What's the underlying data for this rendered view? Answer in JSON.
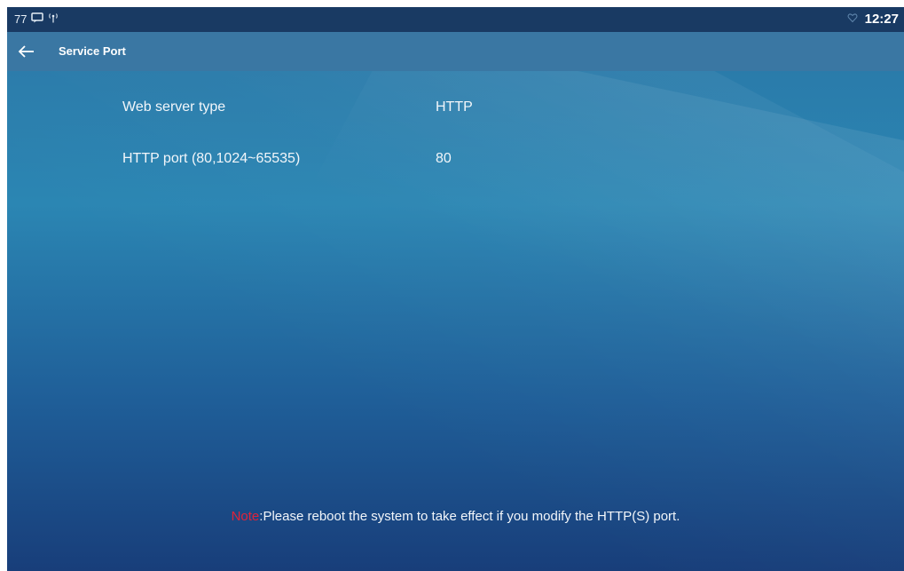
{
  "status_bar": {
    "notification_count": "77",
    "clock": "12:27",
    "icons": [
      "message-icon",
      "antenna-icon",
      "heart-icon"
    ]
  },
  "header": {
    "back_icon": "arrow-left-icon",
    "title": "Service Port"
  },
  "settings": [
    {
      "label": "Web server type",
      "value": "HTTP"
    },
    {
      "label": "HTTP port (80,1024~65535)",
      "value": "80"
    }
  ],
  "note": {
    "prefix": "Note",
    "text": ":Please reboot the system to take effect if you modify the HTTP(S) port."
  },
  "colors": {
    "status_bar": "#193a63",
    "title_bar": "#3a77a3",
    "background_top": "#2a76a6",
    "background_bottom": "#183e7a",
    "note_prefix": "#e0233a",
    "text": "#f2f6fa"
  }
}
